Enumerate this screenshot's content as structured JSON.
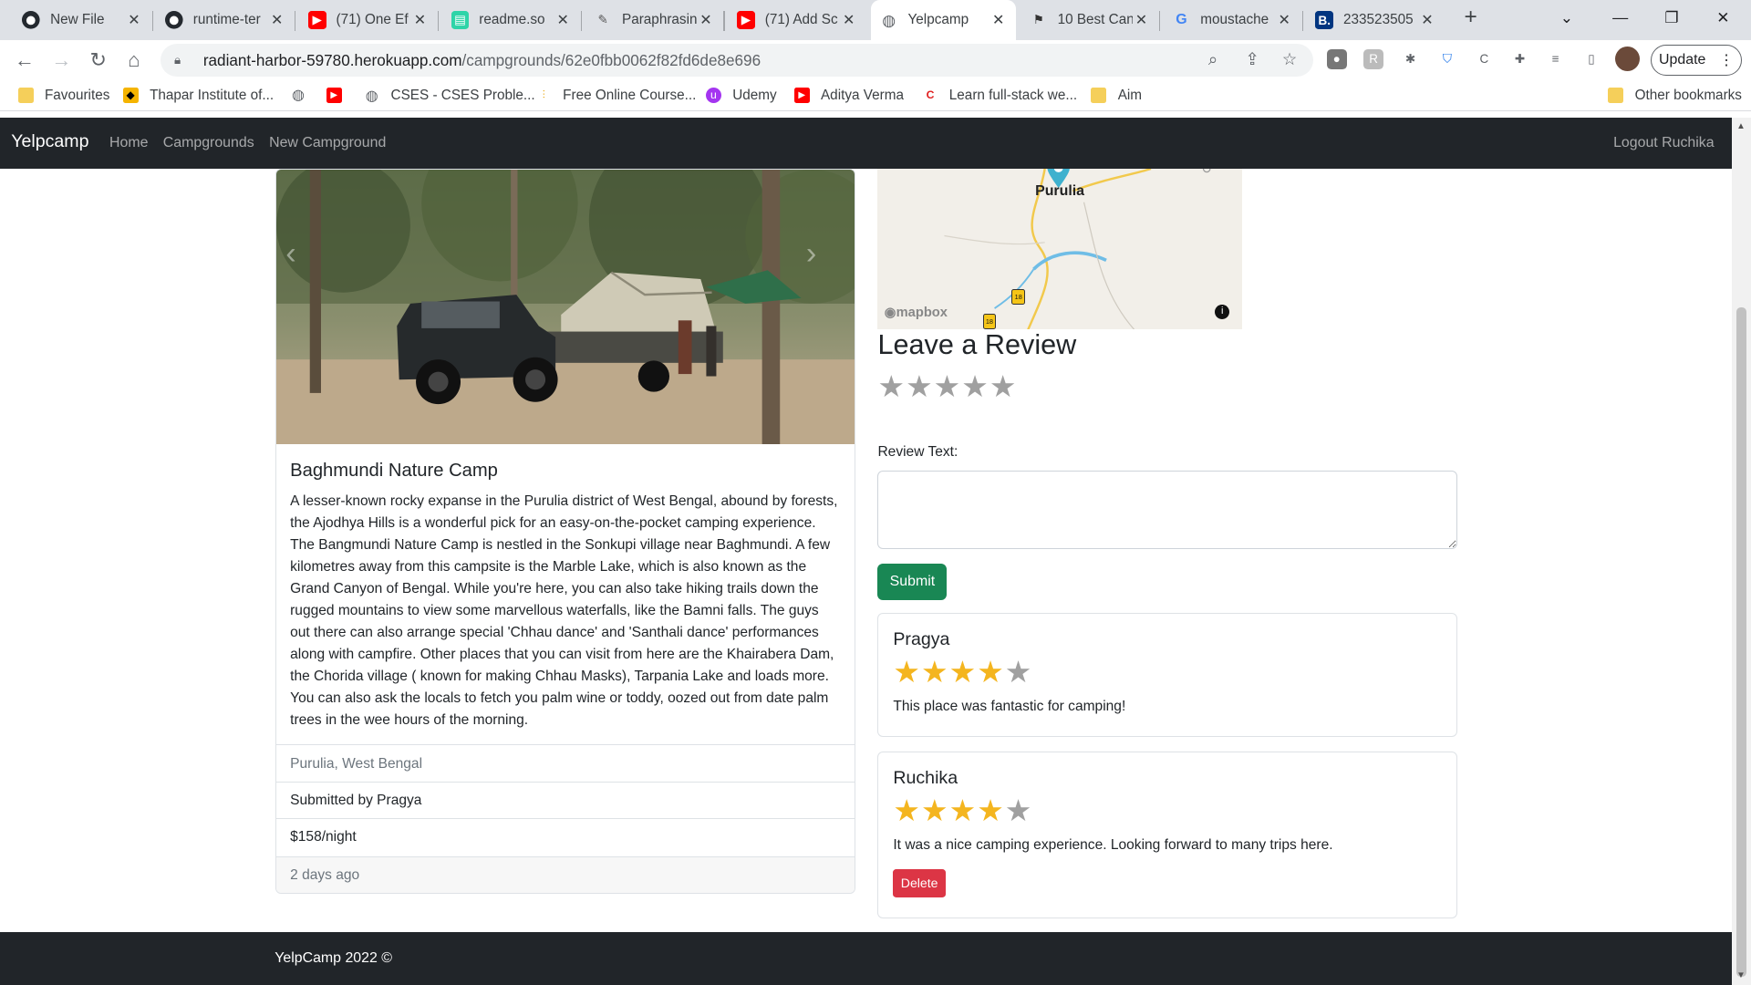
{
  "browser": {
    "tabs": [
      {
        "title": "New File",
        "icon": "github-icon"
      },
      {
        "title": "runtime-ter",
        "icon": "github-icon"
      },
      {
        "title": "(71) One Ef",
        "icon": "youtube-icon"
      },
      {
        "title": "readme.so",
        "icon": "readme-icon"
      },
      {
        "title": "Paraphrasin",
        "icon": "quill-icon"
      },
      {
        "title": "(71) Add Sc",
        "icon": "youtube-icon"
      },
      {
        "title": "Yelpcamp",
        "icon": "globe-icon"
      },
      {
        "title": "10 Best Can",
        "icon": "flag-icon"
      },
      {
        "title": "moustache",
        "icon": "google-icon"
      },
      {
        "title": "233523505",
        "icon": "booking-icon"
      }
    ],
    "url_host": "radiant-harbor-59780.herokuapp.com",
    "url_path": "/campgrounds/62e0fbb0062f82fd6de8e696",
    "update_label": "Update",
    "bookmarks": [
      {
        "label": "Favourites",
        "icon": "folder-icon"
      },
      {
        "label": "Thapar Institute of...",
        "icon": "thapar-icon"
      },
      {
        "label": "",
        "icon": "globe-icon"
      },
      {
        "label": "",
        "icon": "youtube-icon"
      },
      {
        "label": "CSES - CSES Proble...",
        "icon": "globe-icon"
      },
      {
        "label": "Free Online Course...",
        "icon": "course-icon"
      },
      {
        "label": "Udemy",
        "icon": "udemy-icon"
      },
      {
        "label": "Aditya Verma",
        "icon": "youtube-icon"
      },
      {
        "label": "Learn full-stack we...",
        "icon": "codecademy-icon"
      },
      {
        "label": "Aim",
        "icon": "folder-icon"
      }
    ],
    "other_bookmarks": "Other bookmarks"
  },
  "navbar": {
    "brand": "Yelpcamp",
    "links": [
      "Home",
      "Campgrounds",
      "New Campground"
    ],
    "logout": "Logout Ruchika"
  },
  "campground": {
    "title": "Baghmundi Nature Camp",
    "description": "A lesser-known rocky expanse in the Purulia district of West Bengal, abound by forests, the Ajodhya Hills is a wonderful pick for an easy-on-the-pocket camping experience. The Bangmundi Nature Camp is nestled in the Sonkupi village near Baghmundi. A few kilometres away from this campsite is the Marble Lake, which is also known as the Grand Canyon of Bengal. While you're here, you can also take hiking trails down the rugged mountains to view some marvellous waterfalls, like the Bamni falls. The guys out there can also arrange special 'Chhau dance' and 'Santhali dance' performances along with campfire. Other places that you can visit from here are the Khairabera Dam, the Chorida village ( known for making Chhau Masks), Tarpania Lake and loads more. You can also ask the locals to fetch you palm wine or toddy, oozed out from date palm trees in the wee hours of the morning.",
    "location": "Purulia, West Bengal",
    "submitted_by": "Submitted by Pragya",
    "price": "$158/night",
    "posted": "2 days ago"
  },
  "map": {
    "place_label": "Purulia",
    "attribution": "mapbox",
    "road_shields": [
      "18",
      "18"
    ]
  },
  "review_form": {
    "heading": "Leave a Review",
    "rating": 0,
    "text_label": "Review Text:",
    "text_value": "",
    "submit_label": "Submit"
  },
  "reviews": [
    {
      "author": "Pragya",
      "rating": 4,
      "body": "This place was fantastic for camping!",
      "deletable": false
    },
    {
      "author": "Ruchika",
      "rating": 4,
      "body": "It was a nice camping experience. Looking forward to many trips here.",
      "deletable": true,
      "delete_label": "Delete"
    }
  ],
  "footer": {
    "text": "YelpCamp 2022 ©"
  },
  "colors": {
    "navbar": "#212529",
    "submit": "#198754",
    "delete": "#dc3545",
    "star_on": "#f4b51f",
    "star_off": "#a0a0a0"
  }
}
